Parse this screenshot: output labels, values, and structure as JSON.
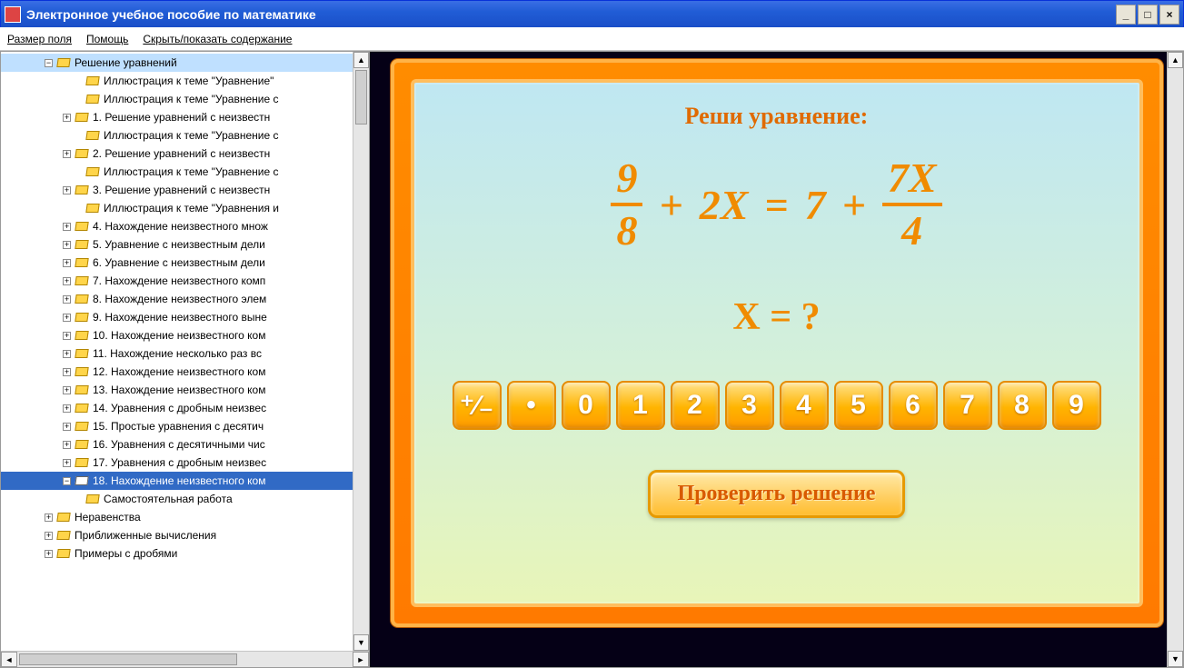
{
  "window": {
    "title": "Электронное учебное пособие по математике"
  },
  "menu": {
    "field_size": "Размер поля",
    "help": "Помощь",
    "toggle_toc": "Скрыть/показать содержание"
  },
  "tree": {
    "section": "Решение уравнений",
    "items": [
      "Иллюстрация к теме \"Уравнение\"",
      "Иллюстрация к теме \"Уравнение с",
      "1. Решение уравнений с неизвестн",
      "Иллюстрация к теме \"Уравнение с",
      "2. Решение уравнений с неизвестн",
      "Иллюстрация к теме \"Уравнение с",
      "3. Решение уравнений с неизвестн",
      "Иллюстрация к теме \"Уравнения и",
      "4. Нахождение неизвестного множ",
      "5. Уравнение с неизвестным дели",
      "6. Уравнение с неизвестным дели",
      "7. Нахождение неизвестного комп",
      "8. Нахождение неизвестного элем",
      "9. Нахождение неизвестного выне",
      "10. Нахождение неизвестного ком",
      "11. Нахождение несколько раз вс",
      "12. Нахождение неизвестного ком",
      "13. Нахождение неизвестного ком",
      "14. Уравнения с дробным неизвес",
      "15. Простые уравнения с десятич",
      "16. Уравнения с десятичными чис",
      "17. Уравнения с дробным неизвес",
      "18. Нахождение неизвестного ком",
      "Самостоятельная работа"
    ],
    "expandable": [
      false,
      false,
      true,
      false,
      true,
      false,
      true,
      false,
      true,
      true,
      true,
      true,
      true,
      true,
      true,
      true,
      true,
      true,
      true,
      true,
      true,
      true,
      true,
      false
    ],
    "selected_index": 22,
    "siblings": [
      "Неравенства",
      "Приближенные вычисления",
      "Примеры с дробями"
    ]
  },
  "lesson": {
    "prompt": "Реши уравнение:",
    "eq": {
      "f1n": "9",
      "f1d": "8",
      "plus1": "+",
      "t2": "2X",
      "eq": "=",
      "t7": "7",
      "plus2": "+",
      "f2n": "7X",
      "f2d": "4"
    },
    "answer_label": "X =  ?",
    "keys": [
      "⁺∕₋",
      "•",
      "0",
      "1",
      "2",
      "3",
      "4",
      "5",
      "6",
      "7",
      "8",
      "9"
    ],
    "check": "Проверить решение"
  }
}
